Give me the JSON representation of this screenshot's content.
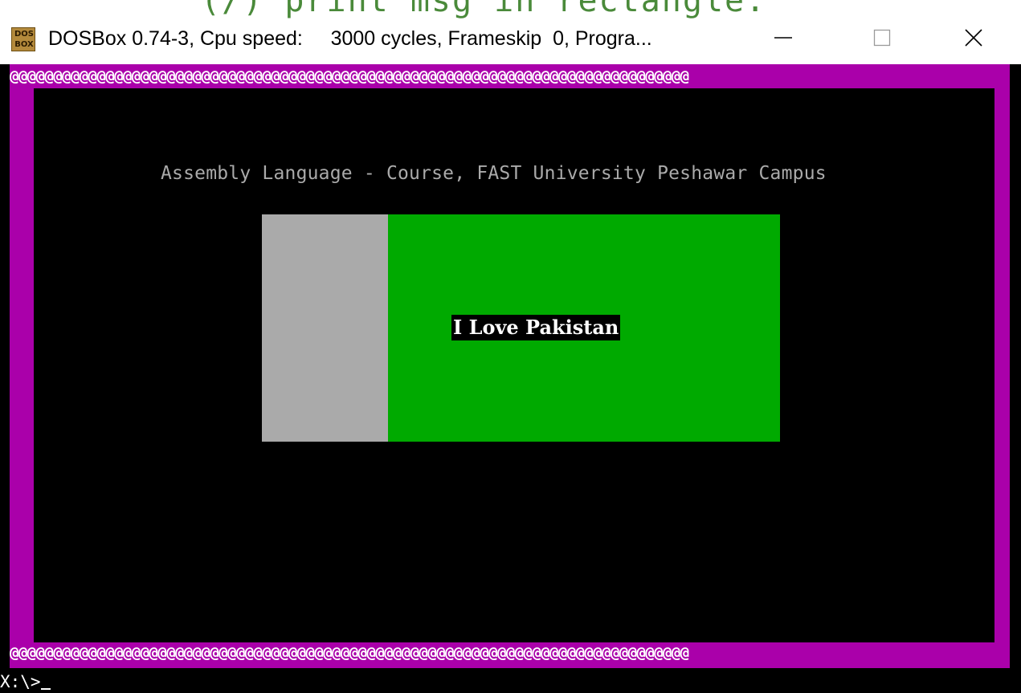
{
  "window": {
    "background_peek_text": "(/) print msg in rectangle.",
    "icon_text_top": "DOS",
    "icon_text_bottom": "BOX",
    "title": "DOSBox 0.74-3, Cpu speed:     3000 cycles, Frameskip  0, Progra...",
    "buttons": [
      "minimize",
      "maximize",
      "close"
    ]
  },
  "dos_screen": {
    "border_char_row": "@@@@@@@@@@@@@@@@@@@@@@@@@@@@@@@@@@@@@@@@@@@@@@@@@@@@@@@@@@@@@@@@@@@@@@@@@@@@@@",
    "heading": "Assembly Language - Course, FAST University Peshawar Campus",
    "message": "I Love Pakistan",
    "prompt": "X:\\>"
  },
  "colors": {
    "border": "#aa00aa",
    "heading": "#aaaaaa",
    "rect_left": "#aaaaaa",
    "rect_right": "#00aa00",
    "message_bg": "#000000",
    "message_fg": "#ffffff"
  }
}
